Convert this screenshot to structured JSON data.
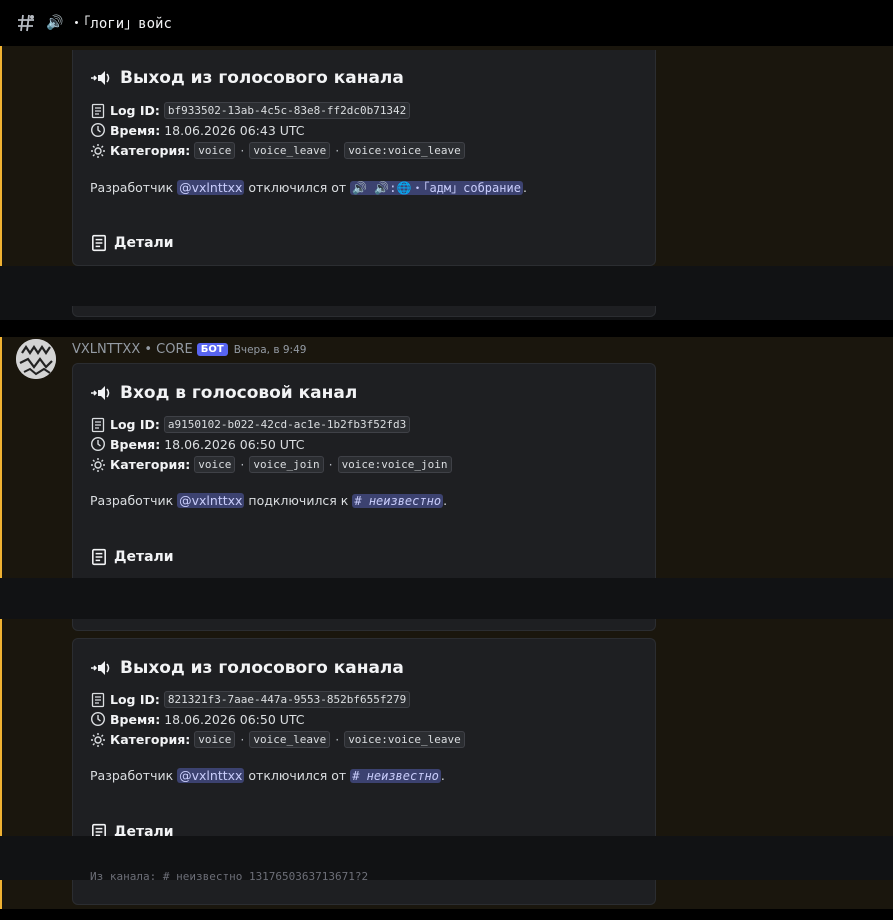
{
  "header": {
    "speaker": "🔊",
    "channel_name": "・「логи」войс"
  },
  "message": {
    "author": "VXLNTTXX • CORE",
    "bot_badge": "БОТ",
    "timestamp": "Вчера, в 9:49"
  },
  "labels": {
    "log_id": "Log ID:",
    "time": "Время:",
    "category": "Категория:",
    "details": "Детали",
    "dot": "·",
    "developer": "Разработчик"
  },
  "embeds": [
    {
      "title": "Выход из голосового канала",
      "log_id": "bf933502-13ab-4c5c-83e8-ff2dc0b71342",
      "time": "18.06.2026 06:43 UTC",
      "categories": [
        "voice",
        "voice_leave",
        "voice:voice_leave"
      ],
      "mention": "@vxlnttxx",
      "action": "отключился от",
      "channel": "🔊 🔊:🌐・「адм」собрание",
      "end": "."
    },
    {
      "title": "Вход в голосовой канал",
      "log_id": "a9150102-b022-42cd-ac1e-1b2fb3f52fd3",
      "time": "18.06.2026 06:50 UTC",
      "categories": [
        "voice",
        "voice_join",
        "voice:voice_join"
      ],
      "mention": "@vxlnttxx",
      "action": "подключился к",
      "channel_hash": "#",
      "channel": "неизвестно",
      "end": "."
    },
    {
      "title": "Выход из голосового канала",
      "log_id": "821321f3-7aae-447a-9553-852bf655f279",
      "time": "18.06.2026 06:50 UTC",
      "categories": [
        "voice",
        "voice_leave",
        "voice:voice_leave"
      ],
      "mention": "@vxlnttxx",
      "action": "отключился от",
      "channel_hash": "#",
      "channel": "неизвестно",
      "end": ".",
      "partial_line": "Из канала: # неизвестно 1317650363713671?2"
    }
  ],
  "colors": {
    "accent": "#f0b232",
    "bot_badge": "#5865f2",
    "mention_bg": "#3c4270"
  }
}
